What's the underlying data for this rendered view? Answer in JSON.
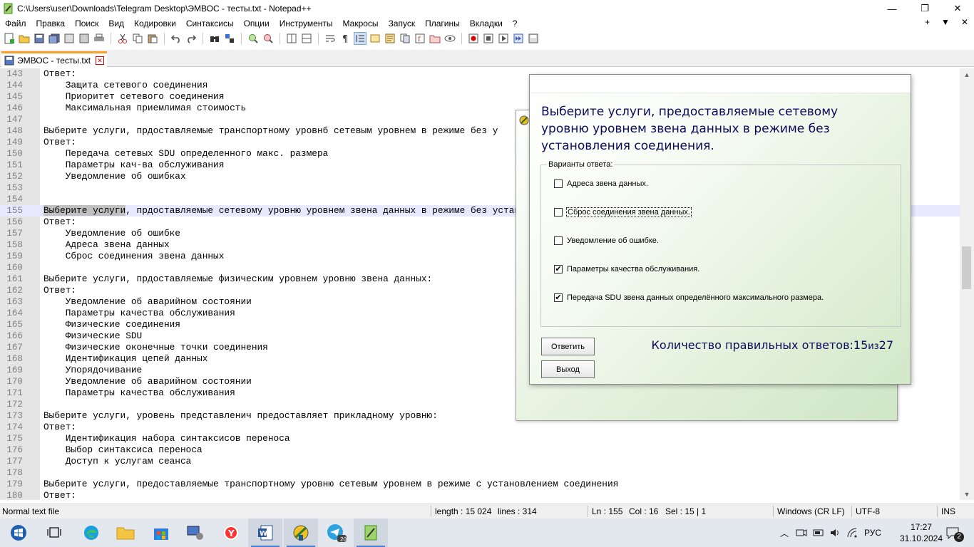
{
  "window": {
    "title": "C:\\Users\\user\\Downloads\\Telegram Desktop\\ЭМВОС - тесты.txt - Notepad++",
    "minimize": "—",
    "maximize": "❐",
    "close": "✕"
  },
  "menu": {
    "items": [
      "Файл",
      "Правка",
      "Поиск",
      "Вид",
      "Кодировки",
      "Синтаксисы",
      "Опции",
      "Инструменты",
      "Макросы",
      "Запуск",
      "Плагины",
      "Вкладки",
      "?"
    ],
    "right": [
      "+",
      "▼",
      "✕"
    ]
  },
  "tab": {
    "label": "ЭМВОС - тесты.txt"
  },
  "editor": {
    "lines": [
      {
        "n": "143",
        "text": "Ответ:"
      },
      {
        "n": "144",
        "text": "    Защита сетевого соединения"
      },
      {
        "n": "145",
        "text": "    Приоритет сетевого соединения"
      },
      {
        "n": "146",
        "text": "    Максимальная приемлимая стоимость"
      },
      {
        "n": "147",
        "text": ""
      },
      {
        "n": "148",
        "text": "Выберите услуги, прдоставляемые транспортному уровнб сетевым уровнем в режиме без у"
      },
      {
        "n": "149",
        "text": "Ответ:"
      },
      {
        "n": "150",
        "text": "    Передача сетевых SDU определенного макс. размера"
      },
      {
        "n": "151",
        "text": "    Параметры кач-ва обслуживания"
      },
      {
        "n": "152",
        "text": "    Уведомление об ошибках"
      },
      {
        "n": "153",
        "text": ""
      },
      {
        "n": "154",
        "text": ""
      },
      {
        "n": "155",
        "sel": "Выберите услуги",
        "text": ", прдоставляемые сетевому уровню уровнем звена данных в режиме без устан"
      },
      {
        "n": "156",
        "text": "Ответ:"
      },
      {
        "n": "157",
        "text": "    Уведомление об ошибке"
      },
      {
        "n": "158",
        "text": "    Адреса звена данных"
      },
      {
        "n": "159",
        "text": "    Сброс соединения звена данных"
      },
      {
        "n": "160",
        "text": ""
      },
      {
        "n": "161",
        "text": "Выберите услуги, прдоставляемые физическим уровнем уровню звена данных:"
      },
      {
        "n": "162",
        "text": "Ответ:"
      },
      {
        "n": "163",
        "text": "    Уведомление об аварийном состоянии"
      },
      {
        "n": "164",
        "text": "    Параметры качества обслуживания"
      },
      {
        "n": "165",
        "text": "    Физические соединения"
      },
      {
        "n": "166",
        "text": "    Физические SDU"
      },
      {
        "n": "167",
        "text": "    Физические оконечные точки соединения"
      },
      {
        "n": "168",
        "text": "    Идентификация цепей данных"
      },
      {
        "n": "169",
        "text": "    Упорядочивание"
      },
      {
        "n": "170",
        "text": "    Уведомление об аварийном состоянии"
      },
      {
        "n": "171",
        "text": "    Параметры качества обслуживания"
      },
      {
        "n": "172",
        "text": ""
      },
      {
        "n": "173",
        "text": "Выберите услуги, уровень представленич предоставляет прикладному уровню:"
      },
      {
        "n": "174",
        "text": "Ответ:"
      },
      {
        "n": "175",
        "text": "    Идентификация набора синтаксисов переноса"
      },
      {
        "n": "176",
        "text": "    Выбор синтаксиса переноса"
      },
      {
        "n": "177",
        "text": "    Доступ к услугам сеанса"
      },
      {
        "n": "178",
        "text": ""
      },
      {
        "n": "179",
        "text": "Выберите услуги, предоставляемые транспортному уровню сетевым уровнем в режиме с установлением соединения"
      },
      {
        "n": "180",
        "text": "Ответ:"
      }
    ]
  },
  "statusbar": {
    "type": "Normal text file",
    "length": "length : 15 024",
    "lines": "lines : 314",
    "ln": "Ln : 155",
    "col": "Col : 16",
    "sel": "Sel : 15 | 1",
    "eol": "Windows (CR LF)",
    "encoding": "UTF-8",
    "mode": "INS"
  },
  "dialog": {
    "question": "Выберите услуги, предоставляемые сетевому уровню уровнем звена данных в режиме без установления соединения.",
    "group_label": "Варианты ответа:",
    "options": [
      {
        "label": "Адреса звена данных.",
        "checked": false
      },
      {
        "label": "Сброс соединения звена данных.",
        "checked": false
      },
      {
        "label": "Уведомление об ошибке.",
        "checked": false
      },
      {
        "label": "Параметры качества обслуживания.",
        "checked": true
      },
      {
        "label": "Передача SDU звена данных определённого максимального размера.",
        "checked": true
      }
    ],
    "answer_button": "Ответить",
    "exit_button": "Выход",
    "score_label": "Количество правильных ответов:",
    "score_correct": "15",
    "score_of": "из",
    "score_total": "27"
  },
  "taskbar": {
    "language": "РУС",
    "time": "17:27",
    "date": "31.10.2024",
    "notifications": "2",
    "telegram_badge": "20"
  },
  "colors": {
    "tab_accent": "#fa9e2a",
    "question_text": "#0a0a5a",
    "dialog_green": "#d2e8c8",
    "current_line": "#e8e8ff"
  }
}
